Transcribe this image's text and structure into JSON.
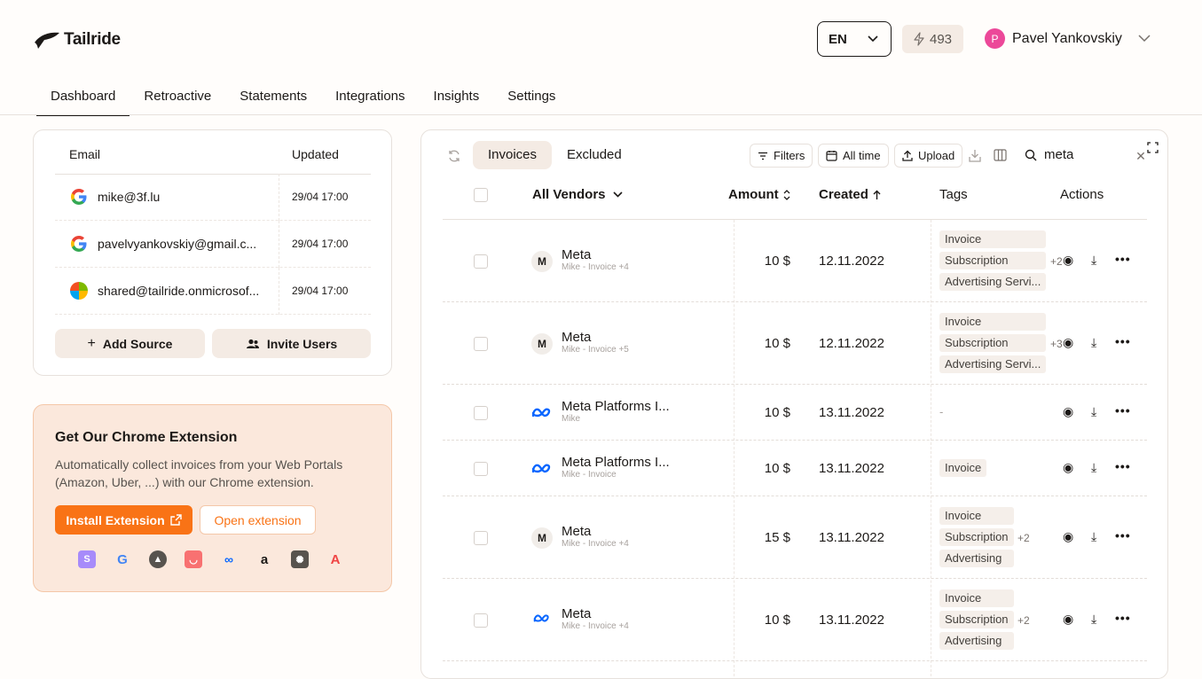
{
  "app": {
    "name": "Tailride"
  },
  "header": {
    "language": "EN",
    "credits": "493",
    "user_initial": "P",
    "user_name": "Pavel Yankovskiy"
  },
  "nav": {
    "tabs": [
      "Dashboard",
      "Retroactive",
      "Statements",
      "Integrations",
      "Insights",
      "Settings"
    ],
    "active": "Dashboard"
  },
  "sources": {
    "col_email": "Email",
    "col_updated": "Updated",
    "rows": [
      {
        "provider": "google-icon",
        "email": "mike@3f.lu",
        "updated": "29/04 17:00"
      },
      {
        "provider": "google-icon",
        "email": "pavelvyankovskiy@gmail.c...",
        "updated": "29/04 17:00"
      },
      {
        "provider": "microsoft-icon",
        "email": "shared@tailride.onmicrosof...",
        "updated": "29/04 17:00"
      }
    ],
    "add_source": "Add Source",
    "invite_users": "Invite Users"
  },
  "extension": {
    "title": "Get Our Chrome Extension",
    "description": "Automatically collect invoices from your Web Portals (Amazon, Uber, ...) with our Chrome extension.",
    "install": "Install Extension",
    "open": "Open extension"
  },
  "table": {
    "tabs": {
      "invoices": "Invoices",
      "excluded": "Excluded"
    },
    "toolbar": {
      "filters": "Filters",
      "all_time": "All time",
      "upload": "Upload",
      "search_value": "meta"
    },
    "headers": {
      "vendors": "All Vendors",
      "amount": "Amount",
      "created": "Created",
      "tags": "Tags",
      "actions": "Actions"
    },
    "rows": [
      {
        "logo": "M",
        "vendor": "Meta",
        "sub": "Mike - Invoice +4",
        "amount": "10 $",
        "date": "12.11.2022",
        "tags": [
          "Invoice",
          "Subscription",
          "Advertising Servi..."
        ],
        "more": "+2"
      },
      {
        "logo": "M",
        "vendor": "Meta",
        "sub": "Mike - Invoice +5",
        "amount": "10 $",
        "date": "12.11.2022",
        "tags": [
          "Invoice",
          "Subscription",
          "Advertising Servi..."
        ],
        "more": "+3"
      },
      {
        "logo": "meta",
        "vendor": "Meta Platforms I...",
        "sub": "Mike",
        "amount": "10 $",
        "date": "13.11.2022",
        "tags": [],
        "empty": "-"
      },
      {
        "logo": "meta",
        "vendor": "Meta Platforms I...",
        "sub": "Mike - Invoice",
        "amount": "10 $",
        "date": "13.11.2022",
        "tags": [
          "Invoice"
        ]
      },
      {
        "logo": "M",
        "vendor": "Meta",
        "sub": "Mike - Invoice +4",
        "amount": "15 $",
        "date": "13.11.2022",
        "tags": [
          "Invoice",
          "Subscription",
          "Advertising"
        ],
        "more": "+2"
      },
      {
        "logo": "meta",
        "vendor": "Meta",
        "sub": "Mike - Invoice +4",
        "amount": "10 $",
        "date": "13.11.2022",
        "tags": [
          "Invoice",
          "Subscription",
          "Advertising"
        ],
        "more": "+2"
      }
    ]
  },
  "colors": {
    "accent": "#f97316",
    "soft": "#f4ebe4",
    "avatar": "#ec4899",
    "meta_blue": "#0866ff"
  }
}
